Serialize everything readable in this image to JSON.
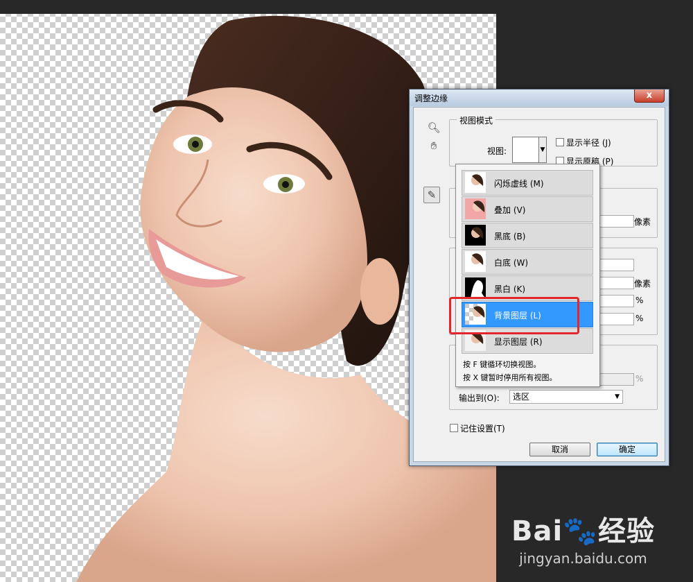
{
  "dialog": {
    "title": "调整边缘",
    "close_label": "x",
    "view_mode_group": "视图模式",
    "view_label": "视图:",
    "show_radius": "显示半径 (J)",
    "show_original": "显示原稿 (P)",
    "unit_pixels_1": "像素",
    "unit_pixels_2": "像素",
    "unit_percent_1": "%",
    "unit_percent_2": "%",
    "unit_percent_3": "%",
    "output_to_label": "输出到(O):",
    "output_to_value": "选区",
    "remember_settings": "记住设置(T)",
    "cancel_label": "取消",
    "ok_label": "确定"
  },
  "view_menu": {
    "items": [
      {
        "label": "闪烁虚线 (M)"
      },
      {
        "label": "叠加 (V)"
      },
      {
        "label": "黑底 (B)"
      },
      {
        "label": "白底 (W)"
      },
      {
        "label": "黑白 (K)"
      },
      {
        "label": "背景图层 (L)"
      },
      {
        "label": "显示图层 (R)"
      }
    ],
    "selected_index": 5,
    "hint_1": "按 F 键循环切换视图。",
    "hint_2": "按 X 键暂时停用所有视图。"
  },
  "watermark": {
    "logo": "Bai",
    "logo_cn": "经验",
    "url": "jingyan.baidu.com"
  },
  "colors": {
    "selected_item": "#3399ff",
    "highlight_box": "#e3262b",
    "background": "#282828"
  }
}
